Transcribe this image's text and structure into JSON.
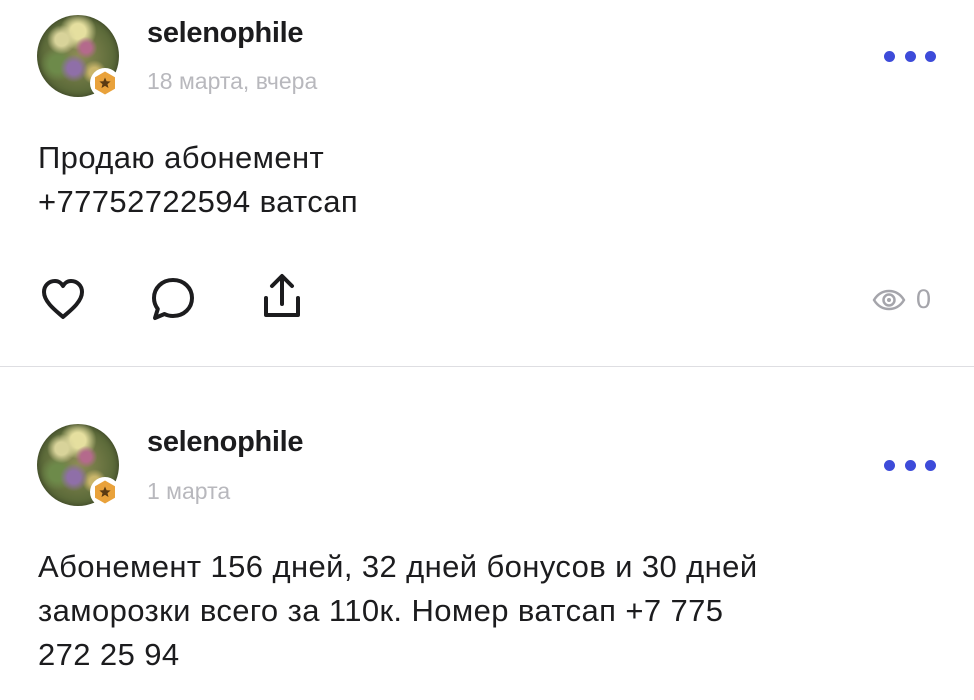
{
  "posts": [
    {
      "username": "selenophile",
      "date": "18 марта, вчера",
      "text_lines": [
        "Продаю абонемент",
        "+77752722594 ватсап"
      ],
      "views": "0"
    },
    {
      "username": "selenophile",
      "date": "1 марта",
      "text_lines": [
        "Абонемент 156 дней, 32 дней бонусов и 30 дней",
        "заморозки всего за 110к. Номер ватсап +7 775",
        "272 25 94"
      ]
    }
  ],
  "icons": {
    "more": "more-dots-icon",
    "like": "heart-icon",
    "comment": "comment-bubble-icon",
    "share": "share-upload-icon",
    "views": "eye-icon",
    "badge": "star-badge-icon"
  },
  "colors": {
    "accent": "#3d4bd9",
    "badge": "#e9a23b",
    "muted": "#b8b8bd"
  }
}
